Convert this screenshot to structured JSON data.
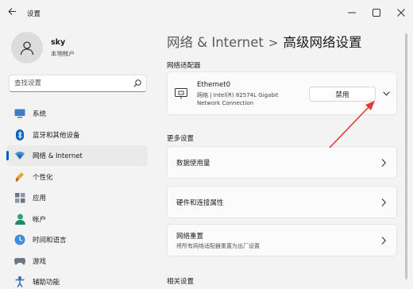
{
  "window": {
    "title": "设置",
    "back_icon": "back-arrow-icon",
    "controls": [
      "minimize-icon",
      "maximize-icon",
      "close-icon"
    ]
  },
  "profile": {
    "name": "sky",
    "account_type": "本地帐户"
  },
  "search": {
    "placeholder": "查找设置"
  },
  "nav": {
    "items": [
      {
        "label": "系统",
        "icon": "system-icon"
      },
      {
        "label": "蓝牙和其他设备",
        "icon": "bluetooth-icon"
      },
      {
        "label": "网络 & Internet",
        "icon": "network-icon",
        "active": true
      },
      {
        "label": "个性化",
        "icon": "personalization-icon"
      },
      {
        "label": "应用",
        "icon": "apps-icon"
      },
      {
        "label": "帐户",
        "icon": "accounts-icon"
      },
      {
        "label": "时间和语言",
        "icon": "time-language-icon"
      },
      {
        "label": "游戏",
        "icon": "gaming-icon"
      },
      {
        "label": "辅助功能",
        "icon": "accessibility-icon"
      }
    ]
  },
  "breadcrumb": {
    "parent": "网络 & Internet",
    "separator": ">",
    "current": "高级网络设置"
  },
  "adapters": {
    "section_title": "网络适配器",
    "adapter": {
      "name": "Ethernet0",
      "description": "网络 | Intel(R) 82574L Gigabit Network Connection",
      "disable_label": "禁用"
    }
  },
  "more_settings": {
    "section_title": "更多设置",
    "rows": [
      {
        "label": "数据使用量",
        "sub": ""
      },
      {
        "label": "硬件和连接属性",
        "sub": ""
      },
      {
        "label": "网络重置",
        "sub": "将所有网络适配器重置为出厂设置"
      }
    ]
  },
  "related": {
    "section_title": "相关设置"
  },
  "colors": {
    "accent": "#005fb8",
    "annotation_arrow": "#e53935",
    "background": "#f3f3f3",
    "card": "#fbfbfb"
  }
}
